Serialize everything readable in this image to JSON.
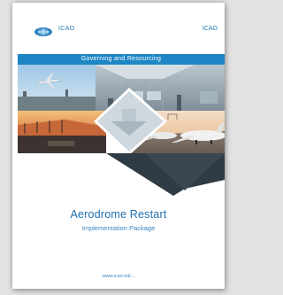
{
  "document": {
    "org_name": "ICAO",
    "corner_label": "ICAO",
    "band_text": "Governing and Resourcing",
    "title": "Aerodrome Restart",
    "subtitle": "Implementation Package",
    "footer_url": "www.icao.int/..."
  },
  "icons": {
    "logo": "icao-emblem-icon"
  },
  "colors": {
    "accent_blue": "#1e86c4",
    "title_blue": "#1e6fb0"
  }
}
